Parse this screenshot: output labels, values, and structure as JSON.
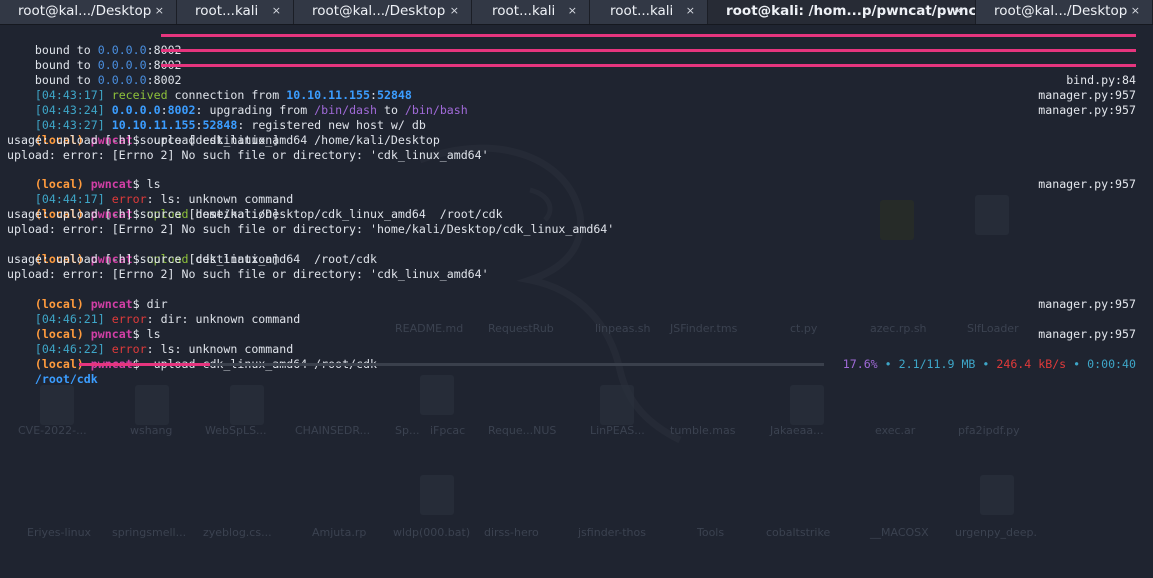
{
  "tabs": [
    {
      "label": "root@kal.../Desktop",
      "close": "×"
    },
    {
      "label": "root...kali",
      "close": "×"
    },
    {
      "label": "root@kal.../Desktop",
      "close": "×"
    },
    {
      "label": "root...kali",
      "close": "×"
    },
    {
      "label": "root...kali",
      "close": "×"
    },
    {
      "label": "root@kali: /hom...p/pwncat/pwncat",
      "close": "×"
    },
    {
      "label": "root@kal.../Desktop",
      "close": "×"
    }
  ],
  "desktop_labels": [
    "CVE-2022-...",
    "wshang",
    "WebSpLS...",
    "CHAINSEDR...",
    "Sp...",
    "iFpcac",
    "Reque...NUS",
    "LinPEAS...",
    "tumble.mas",
    "Jakaeaa...",
    "exec.ar",
    "pfa2ipdf.py",
    "README.md",
    "RequestRub",
    "linpeas.sh",
    "JSFinder.tms",
    "ct.py",
    "azec.rp.sh",
    "SlfLoader",
    "Eriyes-linux",
    "springsmell...",
    "zyeblog.cs...",
    "Amjuta.rp",
    "wldp(000.bat)",
    "dirss-hero",
    "jsfinder-thos",
    "Tools",
    "cobaltstrike",
    "__MACOSX",
    "urgenpy_deep."
  ],
  "terminal": {
    "bound_lines": [
      {
        "prefix": "bound to ",
        "addr": "0.0.0.0",
        "sep": ":",
        "port": "8002"
      },
      {
        "prefix": "bound to ",
        "addr": "0.0.0.0",
        "sep": ":",
        "port": "8002"
      },
      {
        "prefix": "bound to ",
        "addr": "0.0.0.0",
        "sep": ":",
        "port": "8002"
      }
    ],
    "log1": {
      "ts": "[04:43:17]",
      "word": "received",
      "text": " connection from ",
      "ip": "10.10.11.155",
      "sep": ":",
      "port": "52848",
      "src": "bind.py:84"
    },
    "log2": {
      "ts": "[04:43:24]",
      "addr": "0.0.0.0",
      "sep": ":",
      "port": "8002",
      "text1": ": upgrading from ",
      "from": "/bin/dash",
      "to_word": " to ",
      "to": "/bin/bash",
      "src": "manager.py:957"
    },
    "log3": {
      "ts": "[04:43:27]",
      "ip": "10.10.11.155",
      "sep": ":",
      "port": "52848",
      "text": ": registered new host w/ db",
      "src": "manager.py:957"
    },
    "prompt": {
      "local": "(local)",
      "name": "pwncat",
      "dollar": "$"
    },
    "cmd1": "  upload cdk_linux_amd64 /home/kali/Desktop",
    "usage": "usage: upload [-h] source [destination]",
    "err1": "upload: error: [Errno 2] No such file or directory: 'cdk_linux_amd64'",
    "cmd2": " ls",
    "log4": {
      "ts": "[04:44:17]",
      "err": "error",
      "text": ": ls: unknown command",
      "src": "manager.py:957"
    },
    "cmd3": {
      "word": "upload",
      "rest": " home/kali/Desktop/cdk_linux_amd64  /root/cdk"
    },
    "usage2": "usage: upload [-h] source [destination]",
    "err2": "upload: error: [Errno 2] No such file or directory: 'home/kali/Desktop/cdk_linux_amd64'",
    "cmd4": {
      "word": "upload",
      "rest": " cdk_linux_amd64  /root/cdk"
    },
    "usage3": "usage: upload [-h] source [destination]",
    "err3": "upload: error: [Errno 2] No such file or directory: 'cdk_linux_amd64'",
    "cmd5": " dir",
    "log5": {
      "ts": "[04:46:21]",
      "err": "error",
      "text": ": dir: unknown command",
      "src": "manager.py:957"
    },
    "cmd6": " ls",
    "log6": {
      "ts": "[04:46:22]",
      "err": "error",
      "text": ": ls: unknown command",
      "src": "manager.py:957"
    },
    "cmd7": "  upload cdk_linux_amd64 /root/cdk",
    "progress": {
      "path": "/root/cdk",
      "fraction": 0.176,
      "percent": "17.6%",
      "dot": "•",
      "size": "2.1/11.9 MB",
      "speed": "246.4 kB/s",
      "eta": "0:00:40"
    }
  },
  "colors": {
    "accent": "#e6357e",
    "background": "#1f2430"
  }
}
